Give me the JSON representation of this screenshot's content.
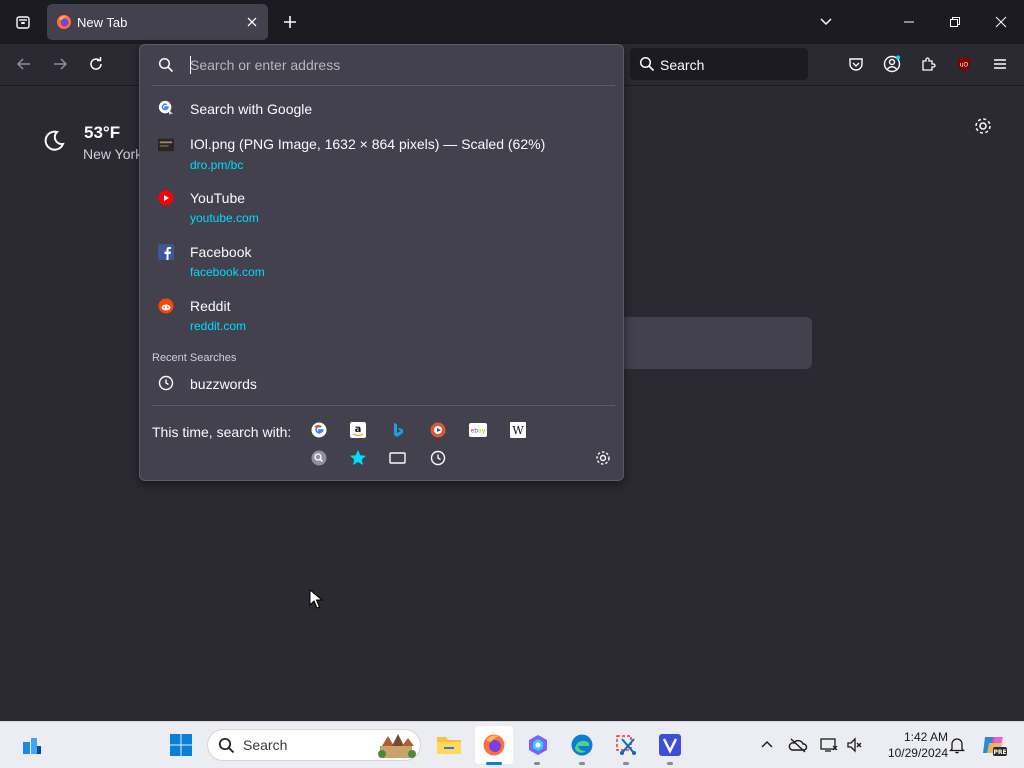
{
  "tab": {
    "title": "New Tab"
  },
  "toolbar": {
    "search_placeholder": "Search"
  },
  "weather": {
    "temperature": "53°F",
    "location": "New York"
  },
  "urlbar": {
    "placeholder": "Search or enter address",
    "results": [
      {
        "title": "Search with Google",
        "url": "",
        "icon": "google-icon"
      },
      {
        "title": "IOl.png (PNG Image, 1632 × 864 pixels) — Scaled (62%)",
        "url": "dro.pm/bc",
        "icon": "image-thumbnail-icon"
      },
      {
        "title": "YouTube",
        "url": "youtube.com",
        "icon": "youtube-icon"
      },
      {
        "title": "Facebook",
        "url": "facebook.com",
        "icon": "facebook-icon"
      },
      {
        "title": "Reddit",
        "url": "reddit.com",
        "icon": "reddit-icon"
      }
    ],
    "recent_label": "Recent Searches",
    "recent": [
      {
        "title": "buzzwords",
        "icon": "clock-icon"
      }
    ],
    "oneoff_label": "This time, search with:",
    "engines": [
      "google-icon",
      "amazon-icon",
      "bing-icon",
      "duckduckgo-icon",
      "ebay-icon",
      "wikipedia-icon"
    ],
    "modes": [
      "search-icon",
      "bookmarks-star-icon",
      "tabs-icon",
      "history-clock-icon"
    ]
  },
  "taskbar": {
    "search_placeholder": "Search",
    "clock": {
      "time": "1:42 AM",
      "date": "10/29/2024"
    }
  },
  "colors": {
    "url_link": "#00ddff",
    "popup_bg": "#42414d",
    "page_bg": "#2b2a33",
    "tabstrip_bg": "#1c1b22"
  }
}
